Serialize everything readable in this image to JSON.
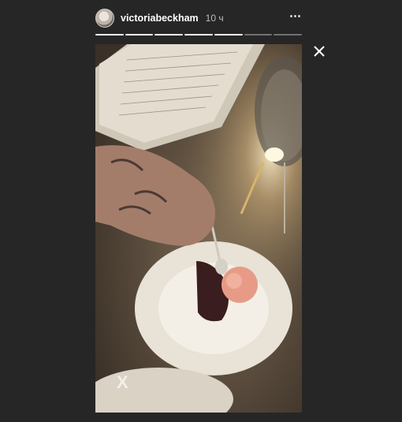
{
  "story": {
    "username": "victoriabeckham",
    "time_ago": "10 ч",
    "more_icon": "⋯",
    "segments_total": 7,
    "segments_done": 5
  },
  "photo": {
    "sticker_text": "X"
  },
  "colors": {
    "background": "#262626",
    "text": "#ffffff",
    "muted_text": "#bdbdbd"
  },
  "icons": [
    "avatar",
    "more-icon",
    "close-icon"
  ]
}
